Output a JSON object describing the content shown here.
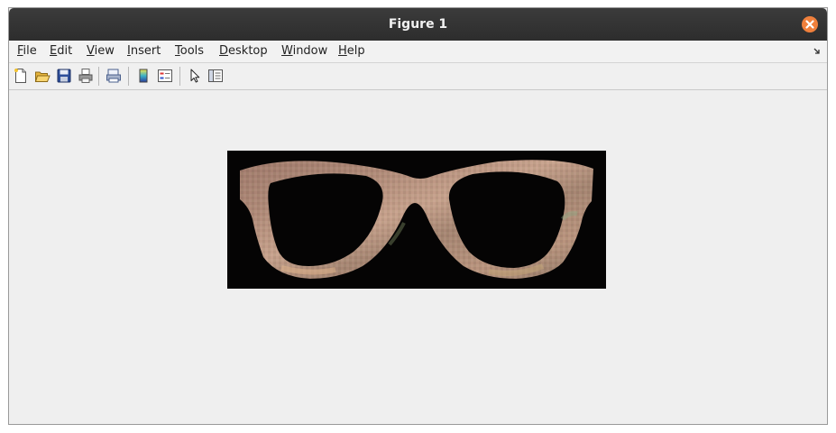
{
  "window": {
    "title": "Figure 1",
    "close_icon": "close-icon",
    "accent_color": "#f0803c"
  },
  "menubar": {
    "items": [
      "File",
      "Edit",
      "View",
      "Insert",
      "Tools",
      "Desktop",
      "Window",
      "Help"
    ]
  },
  "toolbar": {
    "buttons": [
      "new-figure-icon",
      "open-file-icon",
      "save-icon",
      "print-icon",
      "link-plot-icon",
      "insert-colorbar-icon",
      "insert-legend-icon",
      "edit-plot-arrow-icon",
      "property-inspector-icon"
    ]
  },
  "figure": {
    "content": "image",
    "background_color": "#050404"
  }
}
